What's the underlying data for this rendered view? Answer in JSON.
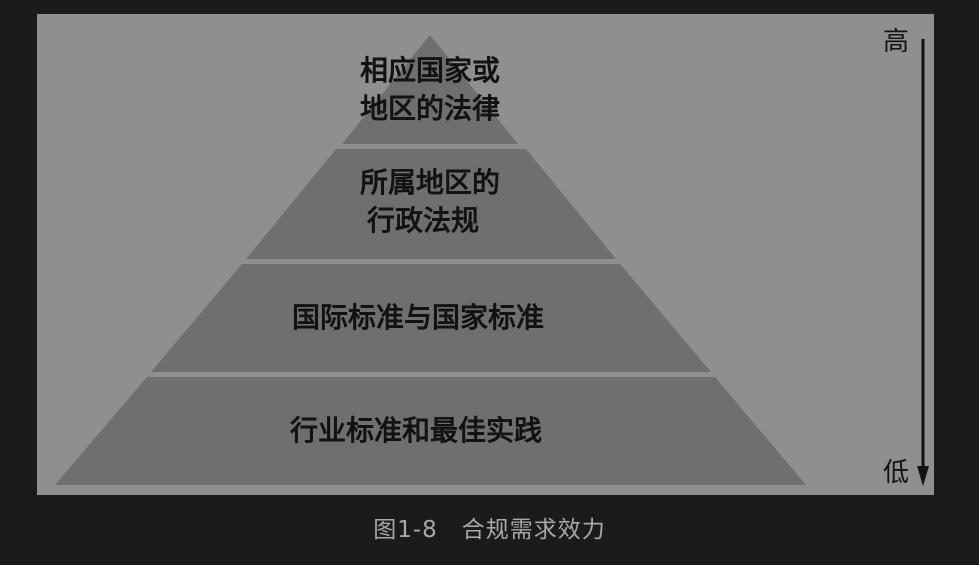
{
  "diagram": {
    "tiers": [
      {
        "lines": [
          "相应国家或",
          "地区的法律"
        ]
      },
      {
        "lines": [
          "所属地区的",
          "行政法规"
        ]
      },
      {
        "lines": [
          "国际标准与国家标准"
        ]
      },
      {
        "lines": [
          "行业标准和最佳实践"
        ]
      }
    ],
    "axis": {
      "top_label": "高",
      "bottom_label": "低"
    },
    "colors": {
      "panel_bg": "#8f8f8d",
      "tier_fill": "#6f6f6d",
      "divider": "#9a9a98",
      "text": "#121212"
    }
  },
  "caption": "图1-8　合规需求效力"
}
